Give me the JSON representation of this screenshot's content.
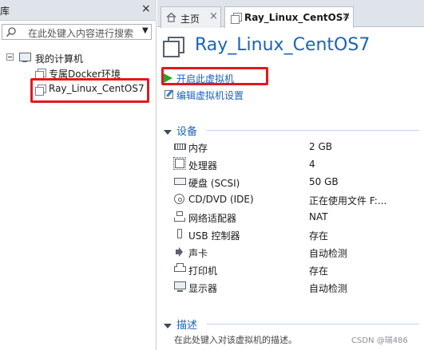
{
  "library": {
    "title": "库",
    "close": "×",
    "search_placeholder": "在此处键入内容进行搜索",
    "search_dropdown": "▼",
    "tree_root": "我的计算机",
    "tree_items": [
      "专属Docker环境",
      "Ray_Linux_CentOS7"
    ]
  },
  "tabs": [
    {
      "label": "主页",
      "close": "×"
    },
    {
      "label": "Ray_Linux_CentOS7",
      "close": "×"
    }
  ],
  "vm": {
    "title": "Ray_Linux_CentOS7",
    "actions": {
      "power_on": "开启此虚拟机",
      "edit_settings": "编辑虚拟机设置"
    }
  },
  "devices": {
    "heading": "设备",
    "items": [
      {
        "name": "内存",
        "value": "2 GB",
        "icon": "memory-icon"
      },
      {
        "name": "处理器",
        "value": "4",
        "icon": "cpu-icon"
      },
      {
        "name": "硬盘 (SCSI)",
        "value": "50 GB",
        "icon": "hard-disk-icon"
      },
      {
        "name": "CD/DVD (IDE)",
        "value": "正在使用文件 F:...",
        "icon": "cd-dvd-icon"
      },
      {
        "name": "网络适配器",
        "value": "NAT",
        "icon": "network-adapter-icon"
      },
      {
        "name": "USB 控制器",
        "value": "存在",
        "icon": "usb-icon"
      },
      {
        "name": "声卡",
        "value": "自动检测",
        "icon": "sound-card-icon"
      },
      {
        "name": "打印机",
        "value": "存在",
        "icon": "printer-icon"
      },
      {
        "name": "显示器",
        "value": "自动检测",
        "icon": "monitor-icon"
      }
    ]
  },
  "description": {
    "heading": "描述",
    "placeholder": "在此处键入对该虚拟机的描述。"
  },
  "watermark": "CSDN @瑞486",
  "colors": {
    "accent": "#1a63b8",
    "highlight": "#e0191f",
    "play": "#2ca02c"
  }
}
